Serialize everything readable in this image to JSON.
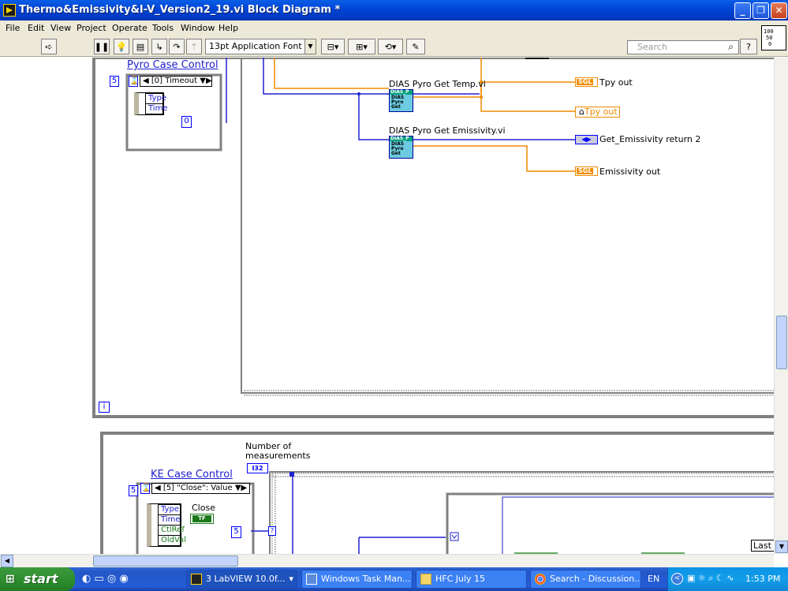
{
  "window": {
    "title": "Thermo&Emissivity&I-V_Version2_19.vi Block Diagram *"
  },
  "caption_buttons": {
    "minimize": "_",
    "restore": "❐",
    "close": "✕"
  },
  "menu": [
    "File",
    "Edit",
    "View",
    "Project",
    "Operate",
    "Tools",
    "Window",
    "Help"
  ],
  "toolbar": {
    "font_select": "13pt Application Font",
    "search_placeholder": "Search",
    "help_label": "?"
  },
  "context_icon": {
    "lines": [
      "100",
      "50",
      "0"
    ]
  },
  "diagram": {
    "pyro_case_control": "Pyro Case Control",
    "pyro_timeout_value": "5",
    "pyro_event_selector": "[0] Timeout",
    "pyro_event_fields": [
      "Type",
      "Time"
    ],
    "pyro_zero_const": "0",
    "dias_temp_label": "DIAS Pyro Get Temp.vi",
    "dias_emiss_label": "DIAS Pyro Get Emissivity.vi",
    "subvi_lines": [
      "DIAS_P",
      "DIAS",
      "Pyro",
      "Get"
    ],
    "tpy_out": "Tpy out",
    "tpy_out_local": "Tpy out",
    "get_emissivity_return": "Get_Emissivity return 2",
    "emissivity_out": "Emissivity out",
    "sgl_tag": "SGL",
    "iteration_terminal": "i",
    "num_measurements": "Number of measurements",
    "i32_tag": "I32",
    "ke_case_control": "KE Case Control",
    "ke_timeout_value": "5",
    "ke_event_selector": "[5] \"Close\": Value",
    "ke_event_fields": [
      "Type",
      "Time",
      "CtlRef",
      "OldVal"
    ],
    "close_label": "Close",
    "tf_tag": "TF",
    "ke_five_const": "5",
    "last_label": "Last"
  },
  "taskbar": {
    "start": "start",
    "tasks": [
      "3 LabVIEW 10.0f...",
      "Windows Task Man...",
      "HFC July 15",
      "Search - Discussion..."
    ],
    "language": "EN",
    "clock": "1:53 PM"
  },
  "colors": {
    "wire_orange": "#f08c00",
    "wire_blue": "#2020d0",
    "frame_gray": "#808080"
  }
}
